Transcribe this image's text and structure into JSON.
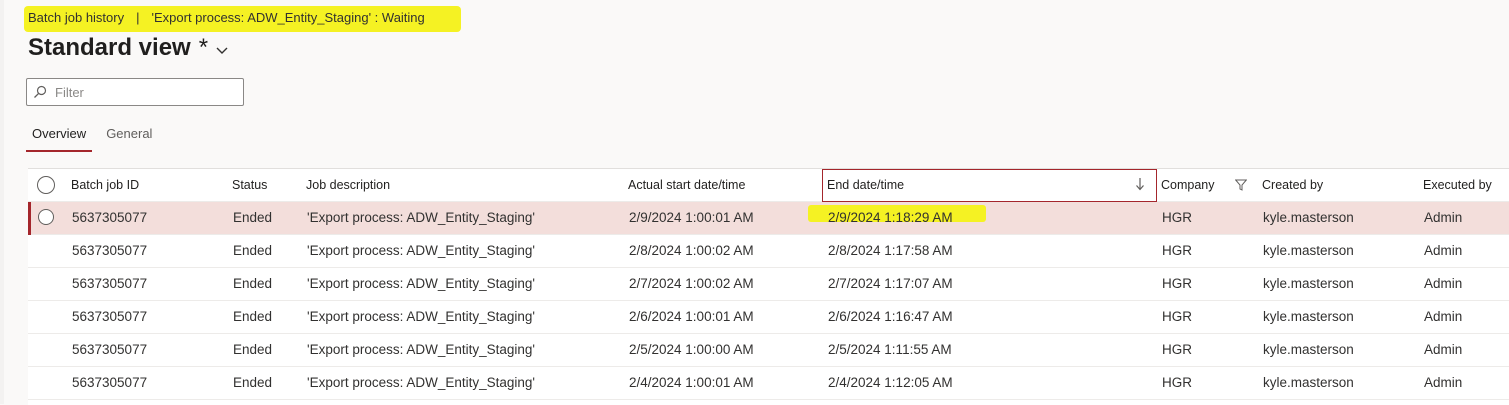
{
  "breadcrumb": {
    "page": "Batch job history",
    "separator": "|",
    "context": "'Export process: ADW_Entity_Staging' : Waiting"
  },
  "view": {
    "title": "Standard view",
    "modified_marker": "*"
  },
  "filter": {
    "placeholder": "Filter",
    "value": ""
  },
  "tabs": [
    {
      "label": "Overview",
      "active": true
    },
    {
      "label": "General",
      "active": false
    }
  ],
  "grid": {
    "columns": [
      "Batch job ID",
      "Status",
      "Job description",
      "Actual start date/time",
      "End date/time",
      "Company",
      "Created by",
      "Executed by"
    ],
    "sorted_column": "End date/time",
    "sort_direction": "descending",
    "rows": [
      {
        "id": "5637305077",
        "status": "Ended",
        "description": "'Export process: ADW_Entity_Staging'",
        "start": "2/9/2024 1:00:01 AM",
        "end": "2/9/2024 1:18:29 AM",
        "company": "HGR",
        "created_by": "kyle.masterson",
        "executed_by": "Admin",
        "selected": true
      },
      {
        "id": "5637305077",
        "status": "Ended",
        "description": "'Export process: ADW_Entity_Staging'",
        "start": "2/8/2024 1:00:02 AM",
        "end": "2/8/2024 1:17:58 AM",
        "company": "HGR",
        "created_by": "kyle.masterson",
        "executed_by": "Admin"
      },
      {
        "id": "5637305077",
        "status": "Ended",
        "description": "'Export process: ADW_Entity_Staging'",
        "start": "2/7/2024 1:00:02 AM",
        "end": "2/7/2024 1:17:07 AM",
        "company": "HGR",
        "created_by": "kyle.masterson",
        "executed_by": "Admin"
      },
      {
        "id": "5637305077",
        "status": "Ended",
        "description": "'Export process: ADW_Entity_Staging'",
        "start": "2/6/2024 1:00:01 AM",
        "end": "2/6/2024 1:16:47 AM",
        "company": "HGR",
        "created_by": "kyle.masterson",
        "executed_by": "Admin"
      },
      {
        "id": "5637305077",
        "status": "Ended",
        "description": "'Export process: ADW_Entity_Staging'",
        "start": "2/5/2024 1:00:00 AM",
        "end": "2/5/2024 1:11:55 AM",
        "company": "HGR",
        "created_by": "kyle.masterson",
        "executed_by": "Admin"
      },
      {
        "id": "5637305077",
        "status": "Ended",
        "description": "'Export process: ADW_Entity_Staging'",
        "start": "2/4/2024 1:00:01 AM",
        "end": "2/4/2024 1:12:05 AM",
        "company": "HGR",
        "created_by": "kyle.masterson",
        "executed_by": "Admin"
      }
    ]
  },
  "colors": {
    "accent": "#a4262c",
    "link": "#2b579a",
    "selected_row": "#f3dedb",
    "highlight": "#f5f223"
  },
  "icons": {
    "filter_field": "search-icon",
    "view": "chevron-down-icon",
    "sort": "arrow-down-icon",
    "column_filter": "funnel-icon"
  }
}
